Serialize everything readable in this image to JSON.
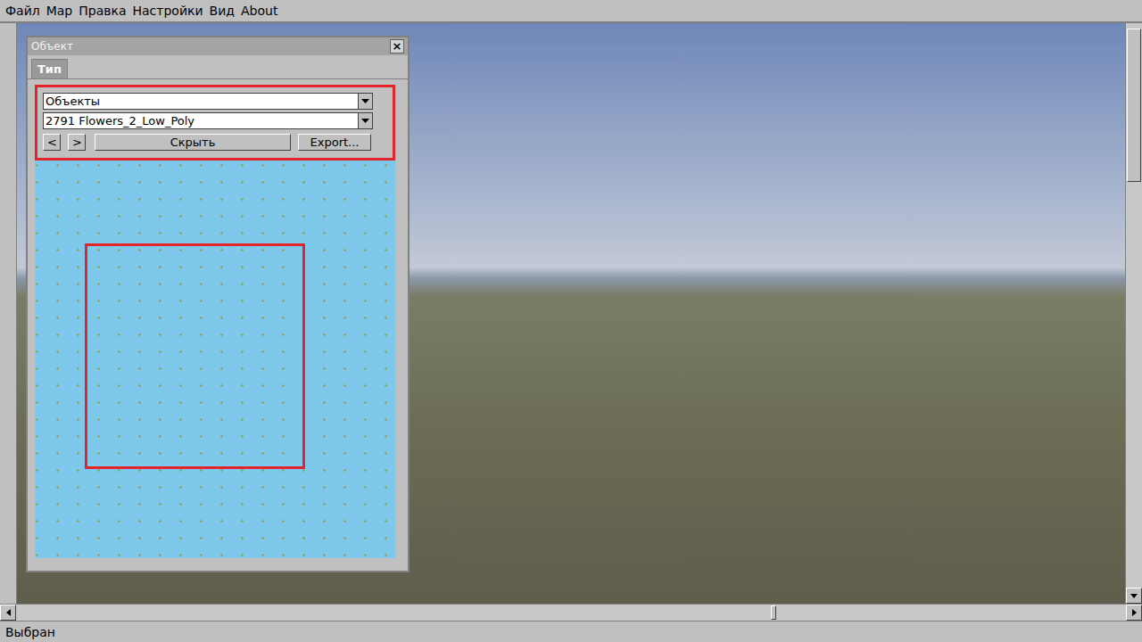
{
  "menu_bar": [
    "Файл",
    "Мар",
    "Правка",
    "Настройки",
    "Вид",
    "About"
  ],
  "object_window": {
    "title": "Объект",
    "close": "×",
    "tabs": [
      {
        "label": "Тип",
        "selected": true
      }
    ],
    "category": "Объекты",
    "object": "2791 Flowers_2_Low_Poly",
    "prev": "<",
    "next": ">",
    "hide": "Скрыть",
    "export": "Export..."
  },
  "scrollbars": {
    "vertical_position": 0,
    "horizontal_position": 0.68
  },
  "status_bar": "Выбран"
}
